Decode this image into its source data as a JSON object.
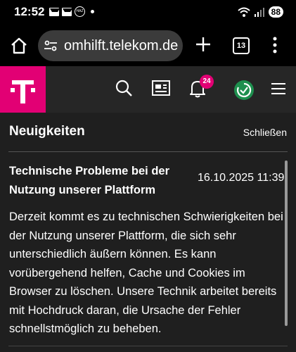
{
  "status": {
    "time": "12:52",
    "haz_label": "HAZ",
    "battery": "88"
  },
  "browser": {
    "url": "omhilft.telekom.de",
    "tab_count": "13"
  },
  "header": {
    "notification_count": "24"
  },
  "news": {
    "title": "Neuigkeiten",
    "close_label": "Schließen",
    "headline": "Technische Probleme bei der Nutzung unserer Plattform",
    "date": "16.10.2025 11:39",
    "body": "Derzeit kommt es zu technischen Schwierigkeiten bei der Nutzung unserer Plattform, die sich sehr unterschiedlich äußern können. Es kann vorübergehend helfen, Cache und Cookies im Browser zu löschen. Unsere Technik arbeitet bereits mit Hochdruck daran, die Ursache der Fehler schnellstmöglich zu beheben."
  },
  "colors": {
    "brand_magenta": "#e20074",
    "header_bg": "#262626",
    "content_bg": "#1f1f1f",
    "status_green": "#1e8f4e"
  },
  "icons": [
    "mail-icon",
    "haz-icon",
    "wifi-icon",
    "signal-icon",
    "home-icon",
    "tune-icon",
    "plus-icon",
    "tabs-icon",
    "more-vert-icon",
    "telekom-logo",
    "search-icon",
    "news-icon",
    "bell-icon",
    "status-icon",
    "hamburger-icon"
  ]
}
